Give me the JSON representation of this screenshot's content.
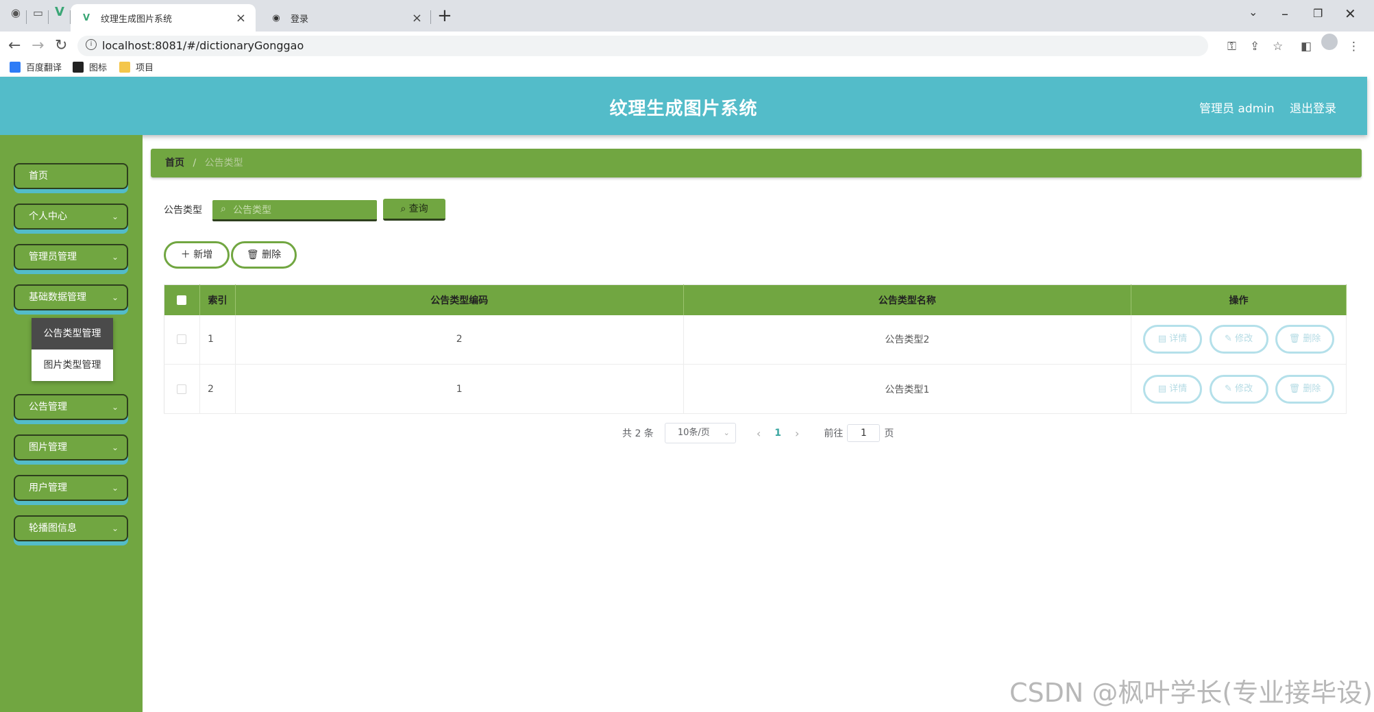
{
  "browser": {
    "tabs": [
      {
        "label": "纹理生成图片系统",
        "active": true
      },
      {
        "label": "登录",
        "active": false
      }
    ],
    "url": "localhost:8081/#/dictionaryGonggao",
    "bookmarks": [
      {
        "label": "百度翻译",
        "icon": "translate-icon"
      },
      {
        "label": "图标",
        "icon": "image-icon"
      },
      {
        "label": "项目",
        "icon": "folder-icon"
      }
    ]
  },
  "header": {
    "title": "纹理生成图片系统",
    "admin": "管理员 admin",
    "logout": "退出登录"
  },
  "sidebar": {
    "items": [
      {
        "label": "首页",
        "expandable": false
      },
      {
        "label": "个人中心",
        "expandable": true
      },
      {
        "label": "管理员管理",
        "expandable": true
      },
      {
        "label": "基础数据管理",
        "expandable": true
      },
      {
        "label": "公告管理",
        "expandable": true
      },
      {
        "label": "图片管理",
        "expandable": true
      },
      {
        "label": "用户管理",
        "expandable": true
      },
      {
        "label": "轮播图信息",
        "expandable": true
      }
    ],
    "submenu": [
      {
        "label": "公告类型管理",
        "active": true
      },
      {
        "label": "图片类型管理",
        "active": false
      }
    ]
  },
  "breadcrumb": {
    "home": "首页",
    "sep": "/",
    "current": "公告类型"
  },
  "search": {
    "label": "公告类型",
    "placeholder": "公告类型",
    "button": "查询"
  },
  "actions": {
    "add": "新增",
    "delete": "删除"
  },
  "table": {
    "columns": [
      "索引",
      "公告类型编码",
      "公告类型名称",
      "操作"
    ],
    "rows": [
      {
        "index": "1",
        "code": "2",
        "name": "公告类型2"
      },
      {
        "index": "2",
        "code": "1",
        "name": "公告类型1"
      }
    ],
    "row_actions": {
      "detail": "详情",
      "edit": "修改",
      "delete": "删除"
    }
  },
  "pagination": {
    "total": "共 2 条",
    "page_size": "10条/页",
    "current_page": "1",
    "goto_label": "前往",
    "goto_value": "1",
    "page_suffix": "页"
  },
  "watermark": "CSDN @枫叶学长(专业接毕设)",
  "colors": {
    "header": "#53bcc9",
    "sidebar": "#71a641",
    "accent_dark": "#2d3f1d",
    "op_button_border": "#b4e0ea"
  }
}
